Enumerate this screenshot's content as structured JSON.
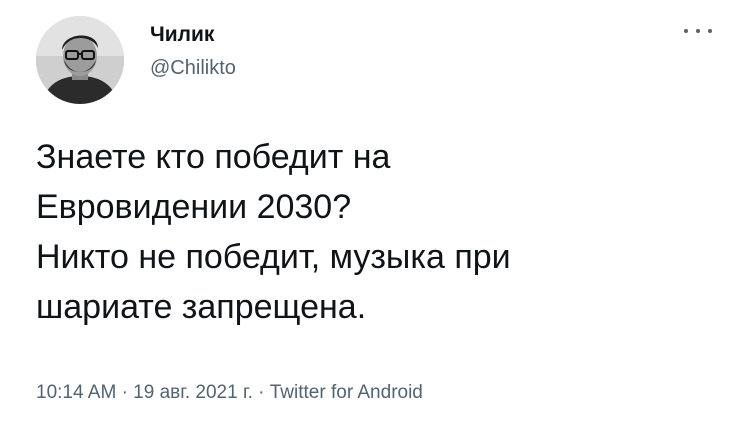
{
  "author": {
    "display_name": "Чилик",
    "handle": "@Chiliktо"
  },
  "tweet": {
    "lines": [
      "Знаете кто победит на",
      "Евровидении 2030?",
      "Никто не победит, музыка при",
      "шариате запрещена."
    ],
    "time": "10:14 AM",
    "separator": "·",
    "date": "19 авг. 2021 г.",
    "source": "Twitter for Android"
  },
  "icons": {
    "more": "more-dots-icon",
    "avatar": "profile-photo"
  },
  "colors": {
    "text": "#0f1419",
    "secondary": "#536471",
    "background": "#ffffff"
  }
}
